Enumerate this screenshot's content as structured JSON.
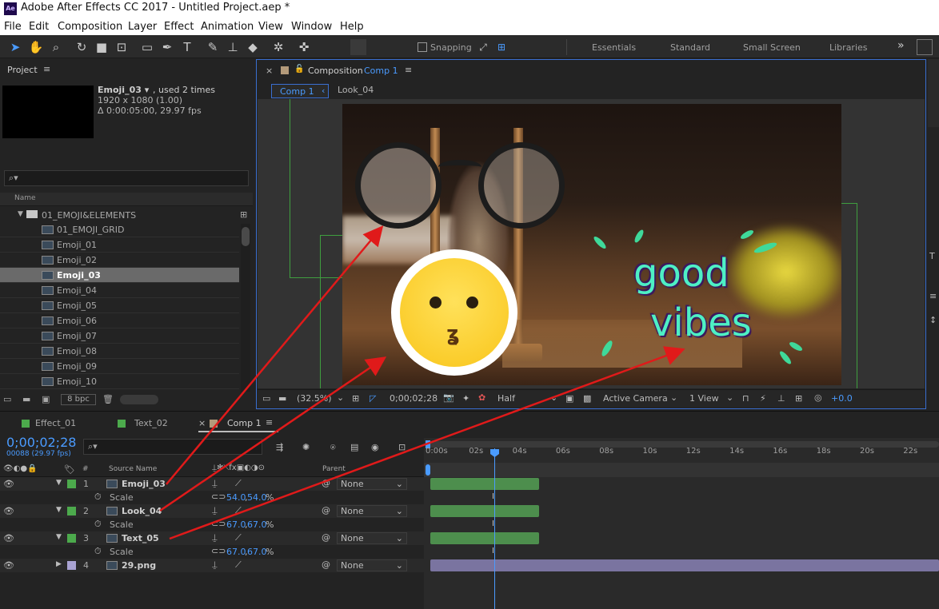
{
  "window": {
    "title": "Adobe After Effects CC 2017 - Untitled Project.aep *",
    "app_icon": "Ae"
  },
  "menu": [
    "File",
    "Edit",
    "Composition",
    "Layer",
    "Effect",
    "Animation",
    "View",
    "Window",
    "Help"
  ],
  "toolbar": {
    "snapping": "Snapping",
    "workspaces": [
      "Essentials",
      "Standard",
      "Small Screen",
      "Libraries"
    ],
    "more": "»"
  },
  "project": {
    "title": "Project",
    "item_name": "Emoji_03 ▾",
    "item_usage": ", used 2 times",
    "item_res": "1920 x 1080 (1.00)",
    "item_dur": "Δ 0:00:05:00, 29.97 fps",
    "col_name": "Name",
    "folder": "01_EMOJI&ELEMENTS",
    "items": [
      "01_EMOJI_GRID",
      "Emoji_01",
      "Emoji_02",
      "Emoji_03",
      "Emoji_04",
      "Emoji_05",
      "Emoji_06",
      "Emoji_07",
      "Emoji_08",
      "Emoji_09",
      "Emoji_10"
    ],
    "selected_index": 3,
    "bpc": "8 bpc"
  },
  "composition": {
    "label": "Composition",
    "name": "Comp 1",
    "tabs": [
      "Comp 1",
      "Look_04"
    ],
    "text_line1": "good",
    "text_line2": "vibes",
    "zoom": "(32.5%)",
    "timecode": "0;00;02;28",
    "resolution": "Half",
    "camera": "Active Camera",
    "views": "1 View",
    "exposure": "+0.0"
  },
  "timeline": {
    "tabs": [
      "Effect_01",
      "Text_02",
      "Comp 1"
    ],
    "timecode": "0;00;02;28",
    "frame_info": "00088 (29.97 fps)",
    "col_num": "#",
    "col_source": "Source Name",
    "col_parent": "Parent",
    "ruler": [
      "0:00s",
      "02s",
      "04s",
      "06s",
      "08s",
      "10s",
      "12s",
      "14s",
      "16s",
      "18s",
      "20s",
      "22s"
    ],
    "layers": [
      {
        "num": "1",
        "name": "Emoji_03",
        "scale_label": "Scale",
        "scale_a": "54.0",
        "scale_b": "54.0",
        "scale_unit": "%",
        "parent": "None"
      },
      {
        "num": "2",
        "name": "Look_04",
        "scale_label": "Scale",
        "scale_a": "67.0",
        "scale_b": "67.0",
        "scale_unit": "%",
        "parent": "None"
      },
      {
        "num": "3",
        "name": "Text_05",
        "scale_label": "Scale",
        "scale_a": "67.0",
        "scale_b": "67.0",
        "scale_unit": "%",
        "parent": "None"
      },
      {
        "num": "4",
        "name": "29.png",
        "parent": "None"
      }
    ]
  },
  "colors": {
    "accent": "#4a9bff",
    "layer_green": "#4d8e4d",
    "arrow_red": "#e01a1a",
    "text_cyan": "#4ef0c4"
  }
}
